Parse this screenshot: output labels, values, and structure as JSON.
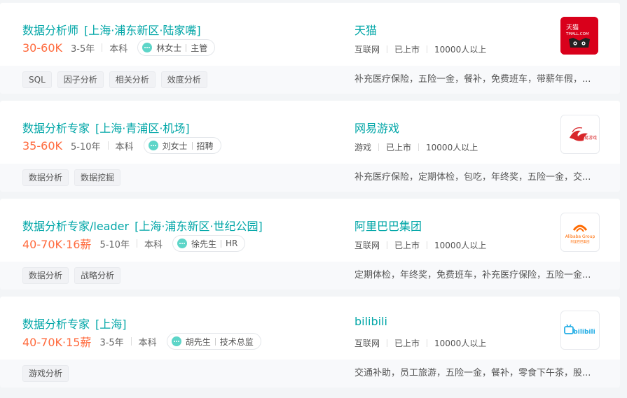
{
  "jobs": [
    {
      "title": "数据分析师",
      "location": "[上海·浦东新区·陆家嘴]",
      "salary": "30-60K",
      "experience": "3-5年",
      "degree": "本科",
      "recruiter_name": "林女士",
      "recruiter_role": "主管",
      "company": "天猫",
      "industry": "互联网",
      "stage": "已上市",
      "size": "10000人以上",
      "logo_text_1": "天猫",
      "logo_text_2": "TMALL.COM",
      "skills": [
        "SQL",
        "因子分析",
        "相关分析",
        "效度分析"
      ],
      "welfare": "补充医疗保险，五险一金，餐补，免费班车，带薪年假，..."
    },
    {
      "title": "数据分析专家",
      "location": "[上海·青浦区·机场]",
      "salary": "35-60K",
      "experience": "5-10年",
      "degree": "本科",
      "recruiter_name": "刘女士",
      "recruiter_role": "招聘",
      "company": "网易游戏",
      "industry": "游戏",
      "stage": "已上市",
      "size": "10000人以上",
      "logo_text_1": "网易游戏",
      "skills": [
        "数据分析",
        "数据挖掘"
      ],
      "welfare": "补充医疗保险，定期体检，包吃，年终奖，五险一金，交..."
    },
    {
      "title": "数据分析专家/leader",
      "location": "[上海·浦东新区·世纪公园]",
      "salary": "40-70K·16薪",
      "experience": "5-10年",
      "degree": "本科",
      "recruiter_name": "徐先生",
      "recruiter_role": "HR",
      "company": "阿里巴巴集团",
      "industry": "互联网",
      "stage": "已上市",
      "size": "10000人以上",
      "logo_text_1": "Alibaba Group",
      "logo_text_2": "阿里巴巴集团",
      "skills": [
        "数据分析",
        "战略分析"
      ],
      "welfare": "定期体检，年终奖，免费班车，补充医疗保险，五险一金..."
    },
    {
      "title": "数据分析专家",
      "location": "[上海]",
      "salary": "40-70K·15薪",
      "experience": "3-5年",
      "degree": "本科",
      "recruiter_name": "胡先生",
      "recruiter_role": "技术总监",
      "company": "bilibili",
      "industry": "互联网",
      "stage": "已上市",
      "size": "10000人以上",
      "logo_text_1": "bilibili",
      "skills": [
        "游戏分析"
      ],
      "welfare": "交通补助，员工旅游，五险一金，餐补，零食下午茶，股..."
    }
  ],
  "colors": {
    "accent": "#00a6a7",
    "salary": "#ff6a3d",
    "tmall_red": "#d9001b",
    "netease_red": "#d8262a",
    "alibaba_orange": "#ff6a00",
    "bilibili_blue": "#23ade5"
  },
  "icons": {
    "recruiter_chat": "chat-bubble-icon"
  }
}
